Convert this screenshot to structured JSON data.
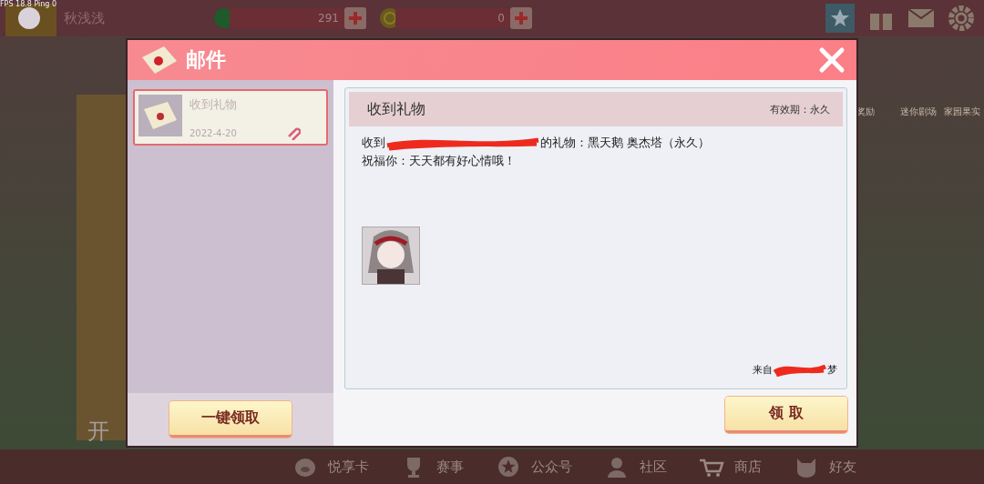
{
  "status_overlay": "FPS 18.8 Ping 0",
  "top_bar": {
    "player_name": "秋浅浅",
    "currencies": [
      {
        "kind": "gem",
        "amount": "291"
      },
      {
        "kind": "coin",
        "amount": "0"
      }
    ]
  },
  "side_shortcuts": [
    {
      "label": "奖励"
    },
    {
      "label": "迷你剧场"
    },
    {
      "label": "家园果实"
    }
  ],
  "background_card": {
    "label": "开"
  },
  "bottom_nav": [
    {
      "kind": "pig",
      "label": "悦享卡"
    },
    {
      "kind": "trophy",
      "label": "赛事"
    },
    {
      "kind": "badge",
      "label": "公众号"
    },
    {
      "kind": "person",
      "label": "社区"
    },
    {
      "kind": "cart",
      "label": "商店"
    },
    {
      "kind": "cat",
      "label": "好友"
    }
  ],
  "mail_dialog": {
    "title": "邮件",
    "mail_list": [
      {
        "subject": "收到礼物",
        "date": "2022-4-20",
        "has_attachment": true,
        "selected": true
      }
    ],
    "claim_all_button": "一键领取",
    "message": {
      "subject": "收到礼物",
      "validity": "有效期：永久",
      "body_lines": [
        [
          {
            "kind": "text",
            "text": "收到"
          },
          {
            "kind": "redaction"
          },
          {
            "kind": "text",
            "text": "的礼物：黑天鹅 奥杰塔（永久）"
          }
        ],
        [
          {
            "kind": "text",
            "text": "祝福你：天天都有好心情哦！"
          }
        ]
      ],
      "attachments": [
        {
          "kind": "picture"
        }
      ],
      "sender": [
        {
          "kind": "text",
          "text": "来自"
        },
        {
          "kind": "redaction"
        },
        {
          "kind": "text",
          "text": "梦"
        }
      ]
    },
    "claim_button": "领 取"
  }
}
